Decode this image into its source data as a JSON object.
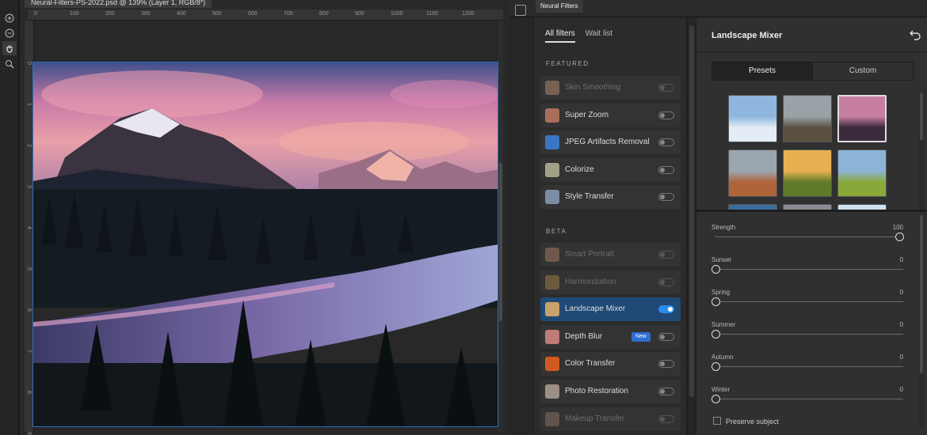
{
  "document": {
    "tab_title": "Neural-Filters-PS-2022.psd @ 139% (Layer 1, RGB/8*)",
    "ruler_h_ticks": [
      "0",
      "100",
      "200",
      "300",
      "400",
      "500",
      "600",
      "700",
      "800",
      "900",
      "1000",
      "1100",
      "1200"
    ],
    "ruler_v_ticks": [
      "0",
      "1",
      "2",
      "3",
      "4",
      "5",
      "6",
      "7",
      "8",
      "9"
    ]
  },
  "tools": [
    {
      "name": "zoom-in-icon"
    },
    {
      "name": "zoom-out-icon"
    },
    {
      "name": "hand-tool-icon",
      "active": true
    },
    {
      "name": "magnifier-icon"
    }
  ],
  "panel": {
    "tab_label": "Neural Filters"
  },
  "filter_list": {
    "tabs": [
      "All filters",
      "Wait list"
    ],
    "featured_heading": "FEATURED",
    "beta_heading": "BETA",
    "featured": [
      {
        "label": "Skin Smoothing",
        "enabled": false,
        "dimmed": true,
        "thumb": "#c99a7e"
      },
      {
        "label": "Super Zoom",
        "enabled": false,
        "dimmed": false,
        "thumb": "#a8705a"
      },
      {
        "label": "JPEG Artifacts Removal",
        "enabled": false,
        "dimmed": false,
        "thumb": "#3a76c4"
      },
      {
        "label": "Colorize",
        "enabled": false,
        "dimmed": false,
        "thumb": "#a3a089"
      },
      {
        "label": "Style Transfer",
        "enabled": false,
        "dimmed": false,
        "thumb": "#7c8ea6"
      }
    ],
    "beta": [
      {
        "label": "Smart Portrait",
        "enabled": false,
        "dimmed": true,
        "thumb": "#b5866c"
      },
      {
        "label": "Harmonization",
        "enabled": false,
        "dimmed": true,
        "thumb": "#b08a48"
      },
      {
        "label": "Landscape Mixer",
        "enabled": true,
        "dimmed": false,
        "selected": true,
        "thumb": "#c7a36b"
      },
      {
        "label": "Depth Blur",
        "enabled": false,
        "dimmed": false,
        "thumb": "#c07a7a",
        "badge": "New"
      },
      {
        "label": "Color Transfer",
        "enabled": false,
        "dimmed": false,
        "thumb": "#d05a20"
      },
      {
        "label": "Photo Restoration",
        "enabled": false,
        "dimmed": false,
        "thumb": "#9c8f86"
      },
      {
        "label": "Makeup Transfer",
        "enabled": false,
        "dimmed": true,
        "thumb": "#9a7a6a"
      }
    ]
  },
  "settings": {
    "title": "Landscape Mixer",
    "segments": [
      "Presets",
      "Custom"
    ],
    "active_segment": "Presets",
    "presets": [
      {
        "name": "winter-lake-preset",
        "sky": "#8fb6df",
        "ground": "#e4ecf5",
        "selected": false
      },
      {
        "name": "mountain-valley-preset",
        "sky": "#9aa2a8",
        "ground": "#5a5040",
        "selected": false
      },
      {
        "name": "sunset-reflection-preset",
        "sky": "#c77fa0",
        "ground": "#3a2a3c",
        "selected": true
      },
      {
        "name": "canyon-preset",
        "sky": "#9aa6b0",
        "ground": "#b0643a",
        "selected": false
      },
      {
        "name": "golden-hills-preset",
        "sky": "#e8b050",
        "ground": "#5f7b2a",
        "selected": false
      },
      {
        "name": "green-meadow-preset",
        "sky": "#8cb4d8",
        "ground": "#8aa83a",
        "selected": false
      }
    ],
    "sliders": [
      {
        "label": "Strength",
        "value": 100,
        "max": 100
      },
      {
        "label": "Sunset",
        "value": 0,
        "max": 100
      },
      {
        "label": "Spring",
        "value": 0,
        "max": 100
      },
      {
        "label": "Summer",
        "value": 0,
        "max": 100
      },
      {
        "label": "Autumn",
        "value": 0,
        "max": 100
      },
      {
        "label": "Winter",
        "value": 0,
        "max": 100
      }
    ],
    "preserve_subject_label": "Preserve subject",
    "preserve_subject_checked": false
  },
  "colors": {
    "accent": "#2d8ceb",
    "selected_row": "#1f4a76",
    "new_badge": "#2d6ed1"
  }
}
